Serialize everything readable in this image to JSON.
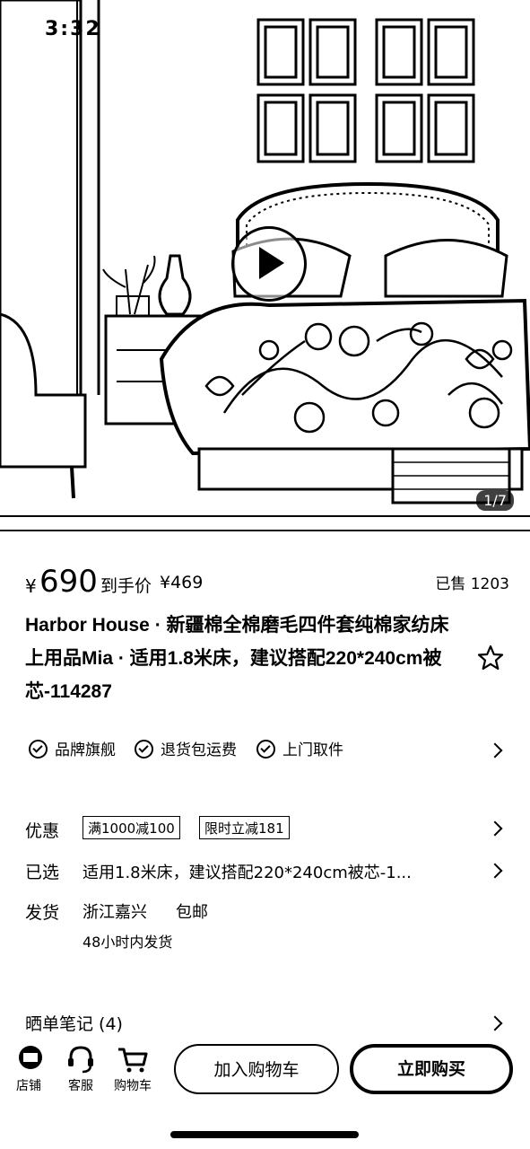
{
  "status_bar": {
    "time": "3:32"
  },
  "gallery": {
    "counter": "1/7"
  },
  "price": {
    "currency": "¥",
    "amount": "690",
    "net_label": "到手价",
    "net_price": "¥469",
    "sold": "已售 1203"
  },
  "product": {
    "title": "Harbor House · 新疆棉全棉磨毛四件套纯棉家纺床上用品Mia · 适用1.8米床，建议搭配220*240cm被芯-114287"
  },
  "services": [
    "品牌旗舰",
    "退货包运费",
    "上门取件"
  ],
  "rows": {
    "discount_label": "优惠",
    "coupons": [
      "满1000减100",
      "限时立减181"
    ],
    "selected_label": "已选",
    "selected_value": "适用1.8米床，建议搭配220*240cm被芯-1...",
    "shipping_label": "发货",
    "shipping_from": "浙江嘉兴",
    "shipping_fee": "包邮",
    "shipping_time": "48小时内发货",
    "reviews": "晒单笔记 (4)"
  },
  "bottom_bar": {
    "store": "店铺",
    "service": "客服",
    "cart": "购物车",
    "add_to_cart": "加入购物车",
    "buy_now": "立即购买"
  },
  "icons": [
    "play-icon",
    "star-icon",
    "check-circle-icon",
    "chevron-right-icon",
    "store-icon",
    "headset-icon",
    "cart-icon"
  ]
}
